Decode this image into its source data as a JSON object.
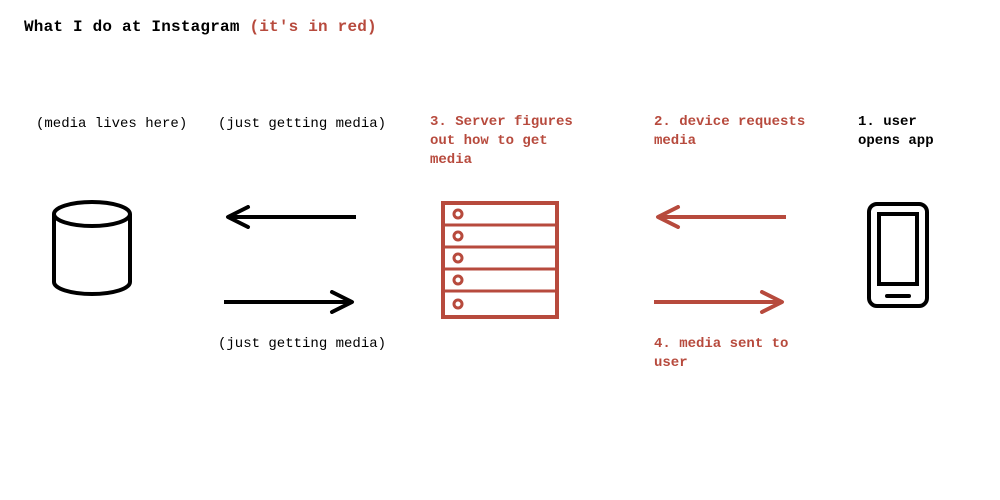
{
  "title": {
    "main": "What I do at Instagram ",
    "highlight": "(it's in red)"
  },
  "colors": {
    "accent": "#b74a3d",
    "ink": "#000000"
  },
  "columns": {
    "storage": {
      "caption": "(media lives here)"
    },
    "fetch": {
      "caption": "(just getting media)",
      "caption2": "(just getting media)"
    },
    "server": {
      "caption": "3. Server figures\nout how to get\nmedia"
    },
    "request": {
      "caption": "2. device requests\nmedia",
      "caption2": "4. media sent to\n   user"
    },
    "device": {
      "caption": "1. user\nopens app"
    }
  }
}
